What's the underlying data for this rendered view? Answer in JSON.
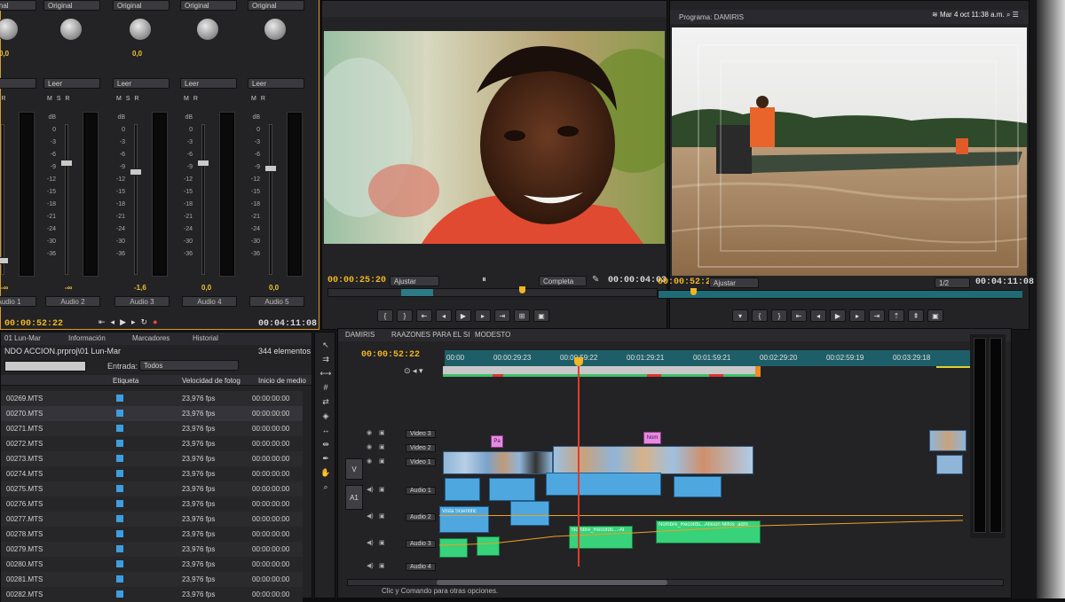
{
  "system": {
    "clock": "Mar 4 oct 11:38 a.m."
  },
  "mixer": {
    "channels": [
      {
        "mode": "Original",
        "pan_value": "0,0",
        "read": "Leer",
        "name": "Audio 1",
        "level": "-∞",
        "has_s": true
      },
      {
        "mode": "Original",
        "pan_value": "",
        "read": "Leer",
        "name": "Audio 2",
        "level": "-∞",
        "has_s": true
      },
      {
        "mode": "Original",
        "pan_value": "0,0",
        "read": "Leer",
        "name": "Audio 3",
        "level": "-1,6",
        "has_s": true
      },
      {
        "mode": "Original",
        "pan_value": "",
        "read": "Leer",
        "name": "Audio 4",
        "level": "0,0",
        "has_s": false
      },
      {
        "mode": "Original",
        "pan_value": "",
        "read": "Leer",
        "name": "Audio 5",
        "level": "0,0",
        "has_s": false
      }
    ],
    "scale": [
      "dB",
      "0",
      "-3",
      "-6",
      "-9",
      "-12",
      "-15",
      "-18",
      "-21",
      "-24",
      "-30",
      "-36"
    ],
    "timecode_current": "00:00:52:22",
    "timecode_duration": "00:04:11:08"
  },
  "source_monitor": {
    "timecode_current": "00:00:25:20",
    "fit": "Ajustar",
    "quality": "Completa",
    "timecode_duration": "00:00:04:03"
  },
  "program_monitor": {
    "tab": "Programa: DAMIRIS",
    "timecode_current": "00:00:52:22",
    "fit": "Ajustar",
    "quality": "1/2",
    "timecode_duration": "00:04:11:08"
  },
  "project": {
    "tabs": [
      "01 Lun-Mar",
      "Información",
      "Marcadores",
      "Historial"
    ],
    "path": "NDO ACCION.prproj\\01 Lun-Mar",
    "count": "344 elementos",
    "entry_label": "Entrada:",
    "entry_value": "Todos",
    "columns": [
      "Etiqueta",
      "Velocidad de fotog",
      "Inicio de medio"
    ],
    "rows": [
      {
        "name": "00269.MTS",
        "fps": "23,976 fps",
        "start": "00:00:00:00"
      },
      {
        "name": "00270.MTS",
        "fps": "23,976 fps",
        "start": "00:00:00:00"
      },
      {
        "name": "00271.MTS",
        "fps": "23,976 fps",
        "start": "00:00:00:00"
      },
      {
        "name": "00272.MTS",
        "fps": "23,976 fps",
        "start": "00:00:00:00"
      },
      {
        "name": "00273.MTS",
        "fps": "23,976 fps",
        "start": "00:00:00:00"
      },
      {
        "name": "00274.MTS",
        "fps": "23,976 fps",
        "start": "00:00:00:00"
      },
      {
        "name": "00275.MTS",
        "fps": "23,976 fps",
        "start": "00:00:00:00"
      },
      {
        "name": "00276.MTS",
        "fps": "23,976 fps",
        "start": "00:00:00:00"
      },
      {
        "name": "00277.MTS",
        "fps": "23,976 fps",
        "start": "00:00:00:00"
      },
      {
        "name": "00278.MTS",
        "fps": "23,976 fps",
        "start": "00:00:00:00"
      },
      {
        "name": "00279.MTS",
        "fps": "23,976 fps",
        "start": "00:00:00:00"
      },
      {
        "name": "00280.MTS",
        "fps": "23,976 fps",
        "start": "00:00:00:00"
      },
      {
        "name": "00281.MTS",
        "fps": "23,976 fps",
        "start": "00:00:00:00"
      },
      {
        "name": "00282.MTS",
        "fps": "23,976 fps",
        "start": "00:00:00:00"
      }
    ]
  },
  "timeline": {
    "tabs": [
      "DAMIRIS",
      "RAAZONES PARA EL SI",
      "MODESTO"
    ],
    "timecode": "00:00:52:22",
    "ruler": [
      "00:00",
      "00:00:29:23",
      "00:00:59:22",
      "00:01:29:21",
      "00:01:59:21",
      "00:02:29:20",
      "00:02:59:19",
      "00:03:29:18"
    ],
    "tracks": [
      "Video 3",
      "Video 2",
      "Video 1",
      "Audio 1",
      "Audio 2",
      "Audio 3",
      "Audio 4"
    ],
    "target_v": "V",
    "target_a": "A1",
    "title_clips": [
      "Pa",
      "Nom"
    ],
    "clip_labels": [
      "Vista Scientific",
      "Nombre_Records...-Al",
      "Nombre_Records...Allison Mifos_adm"
    ],
    "status": "Clic y Comando para otras opciones."
  },
  "colors": {
    "accent": "#f0b623",
    "panel": "#232326",
    "label_blue": "#3c9ee0",
    "audio_green": "#37d27a",
    "playhead": "#e23a2a"
  }
}
